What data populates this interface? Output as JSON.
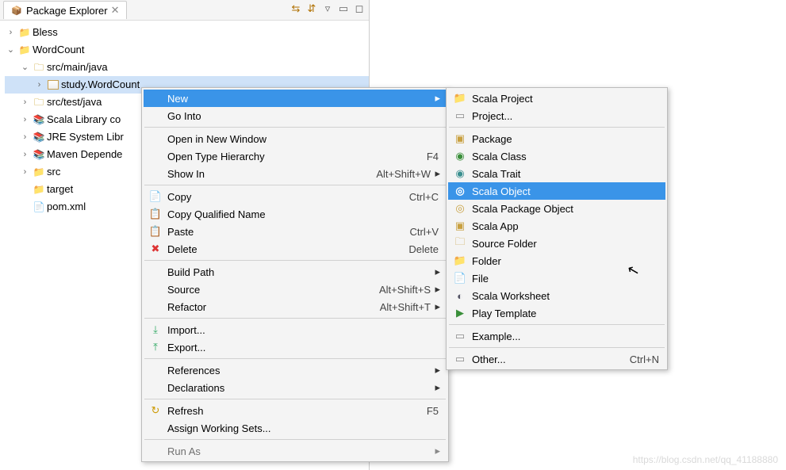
{
  "header": {
    "title": "Package Explorer"
  },
  "tree": {
    "bless": "Bless",
    "wordcount": "WordCount",
    "src_main_java": "src/main/java",
    "study_pkg": "study.WordCount",
    "src_test_java": "src/test/java",
    "scala_lib": "Scala Library co",
    "jre_lib": "JRE System Libr",
    "maven_deps": "Maven Depende",
    "src": "src",
    "target": "target",
    "pom": "pom.xml"
  },
  "ctx": {
    "new": "New",
    "go_into": "Go Into",
    "open_new_window": "Open in New Window",
    "open_type_hierarchy": "Open Type Hierarchy",
    "open_type_hierarchy_sc": "F4",
    "show_in": "Show In",
    "show_in_sc": "Alt+Shift+W",
    "copy": "Copy",
    "copy_sc": "Ctrl+C",
    "copy_qual": "Copy Qualified Name",
    "paste": "Paste",
    "paste_sc": "Ctrl+V",
    "delete": "Delete",
    "delete_sc": "Delete",
    "build_path": "Build Path",
    "source": "Source",
    "source_sc": "Alt+Shift+S",
    "refactor": "Refactor",
    "refactor_sc": "Alt+Shift+T",
    "import": "Import...",
    "export": "Export...",
    "references": "References",
    "declarations": "Declarations",
    "refresh": "Refresh",
    "refresh_sc": "F5",
    "assign_ws": "Assign Working Sets...",
    "run_as": "Run As"
  },
  "sub": {
    "scala_project": "Scala Project",
    "project": "Project...",
    "package": "Package",
    "scala_class": "Scala Class",
    "scala_trait": "Scala Trait",
    "scala_object": "Scala Object",
    "scala_pkg_obj": "Scala Package Object",
    "scala_app": "Scala App",
    "source_folder": "Source Folder",
    "folder": "Folder",
    "file": "File",
    "scala_worksheet": "Scala Worksheet",
    "play_template": "Play Template",
    "example": "Example...",
    "other": "Other...",
    "other_sc": "Ctrl+N"
  },
  "watermark": "https://blog.csdn.net/qq_41188880"
}
